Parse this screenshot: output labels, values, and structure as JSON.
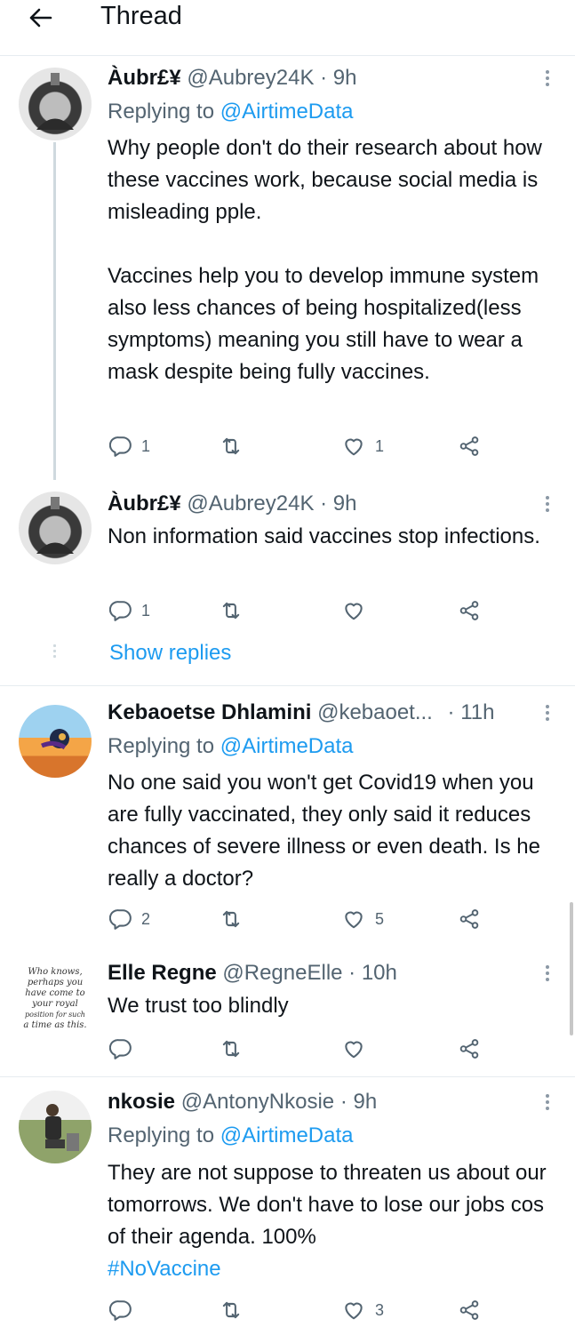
{
  "header": {
    "title": "Thread",
    "back_icon": "arrow-left-icon"
  },
  "tweets": [
    {
      "name": "Àubr£¥",
      "handle": "@Aubrey24K",
      "time": "· 9h",
      "replying_label": "Replying to",
      "replying_handle": "@AirtimeData",
      "text1": "Why people don't do their research about how these vaccines work, because social media is misleading pple.",
      "text2": "Vaccines help you to develop immune system also less chances of being hospitalized(less symptoms) meaning you still have to wear a mask despite being fully vaccines.",
      "replies": "1",
      "retweets": "",
      "likes": "1"
    },
    {
      "name": "Àubr£¥",
      "handle": "@Aubrey24K",
      "time": "· 9h",
      "text1": "Non information said vaccines stop infections.",
      "replies": "1",
      "retweets": "",
      "likes": "",
      "show_replies": "Show replies"
    },
    {
      "name": "Kebaoetse Dhlamini",
      "handle": "@kebaoet...",
      "time": "· 11h",
      "replying_label": "Replying to",
      "replying_handle": "@AirtimeData",
      "text1": "No one said you won't get Covid19 when you are fully vaccinated, they only said it reduces chances of severe illness or even death. Is he really a doctor?",
      "replies": "2",
      "retweets": "",
      "likes": "5"
    },
    {
      "name": "Elle Regne",
      "handle": "@RegneElle",
      "time": "· 10h",
      "text1": "We trust too blindly",
      "avatar_text": [
        "Who knows,",
        "perhaps you",
        "have come to",
        "your royal",
        "position for such",
        "a time as this."
      ],
      "replies": "",
      "retweets": "",
      "likes": ""
    },
    {
      "name": "nkosie",
      "handle": "@AntonyNkosie",
      "time": "· 9h",
      "replying_label": "Replying to",
      "replying_handle": "@AirtimeData",
      "text1": "They are not suppose to threaten us about our tomorrows. We don't have to lose our jobs cos of their agenda. 100%",
      "hashtag": "#NoVaccine",
      "replies": "",
      "retweets": "",
      "likes": "3"
    }
  ],
  "icons": [
    "reply-icon",
    "retweet-icon",
    "like-icon",
    "share-icon",
    "more-icon"
  ],
  "colors": {
    "text": "#0f1419",
    "secondary": "#536471",
    "accent": "#1d9bf0",
    "divider": "#e6ecf0"
  }
}
